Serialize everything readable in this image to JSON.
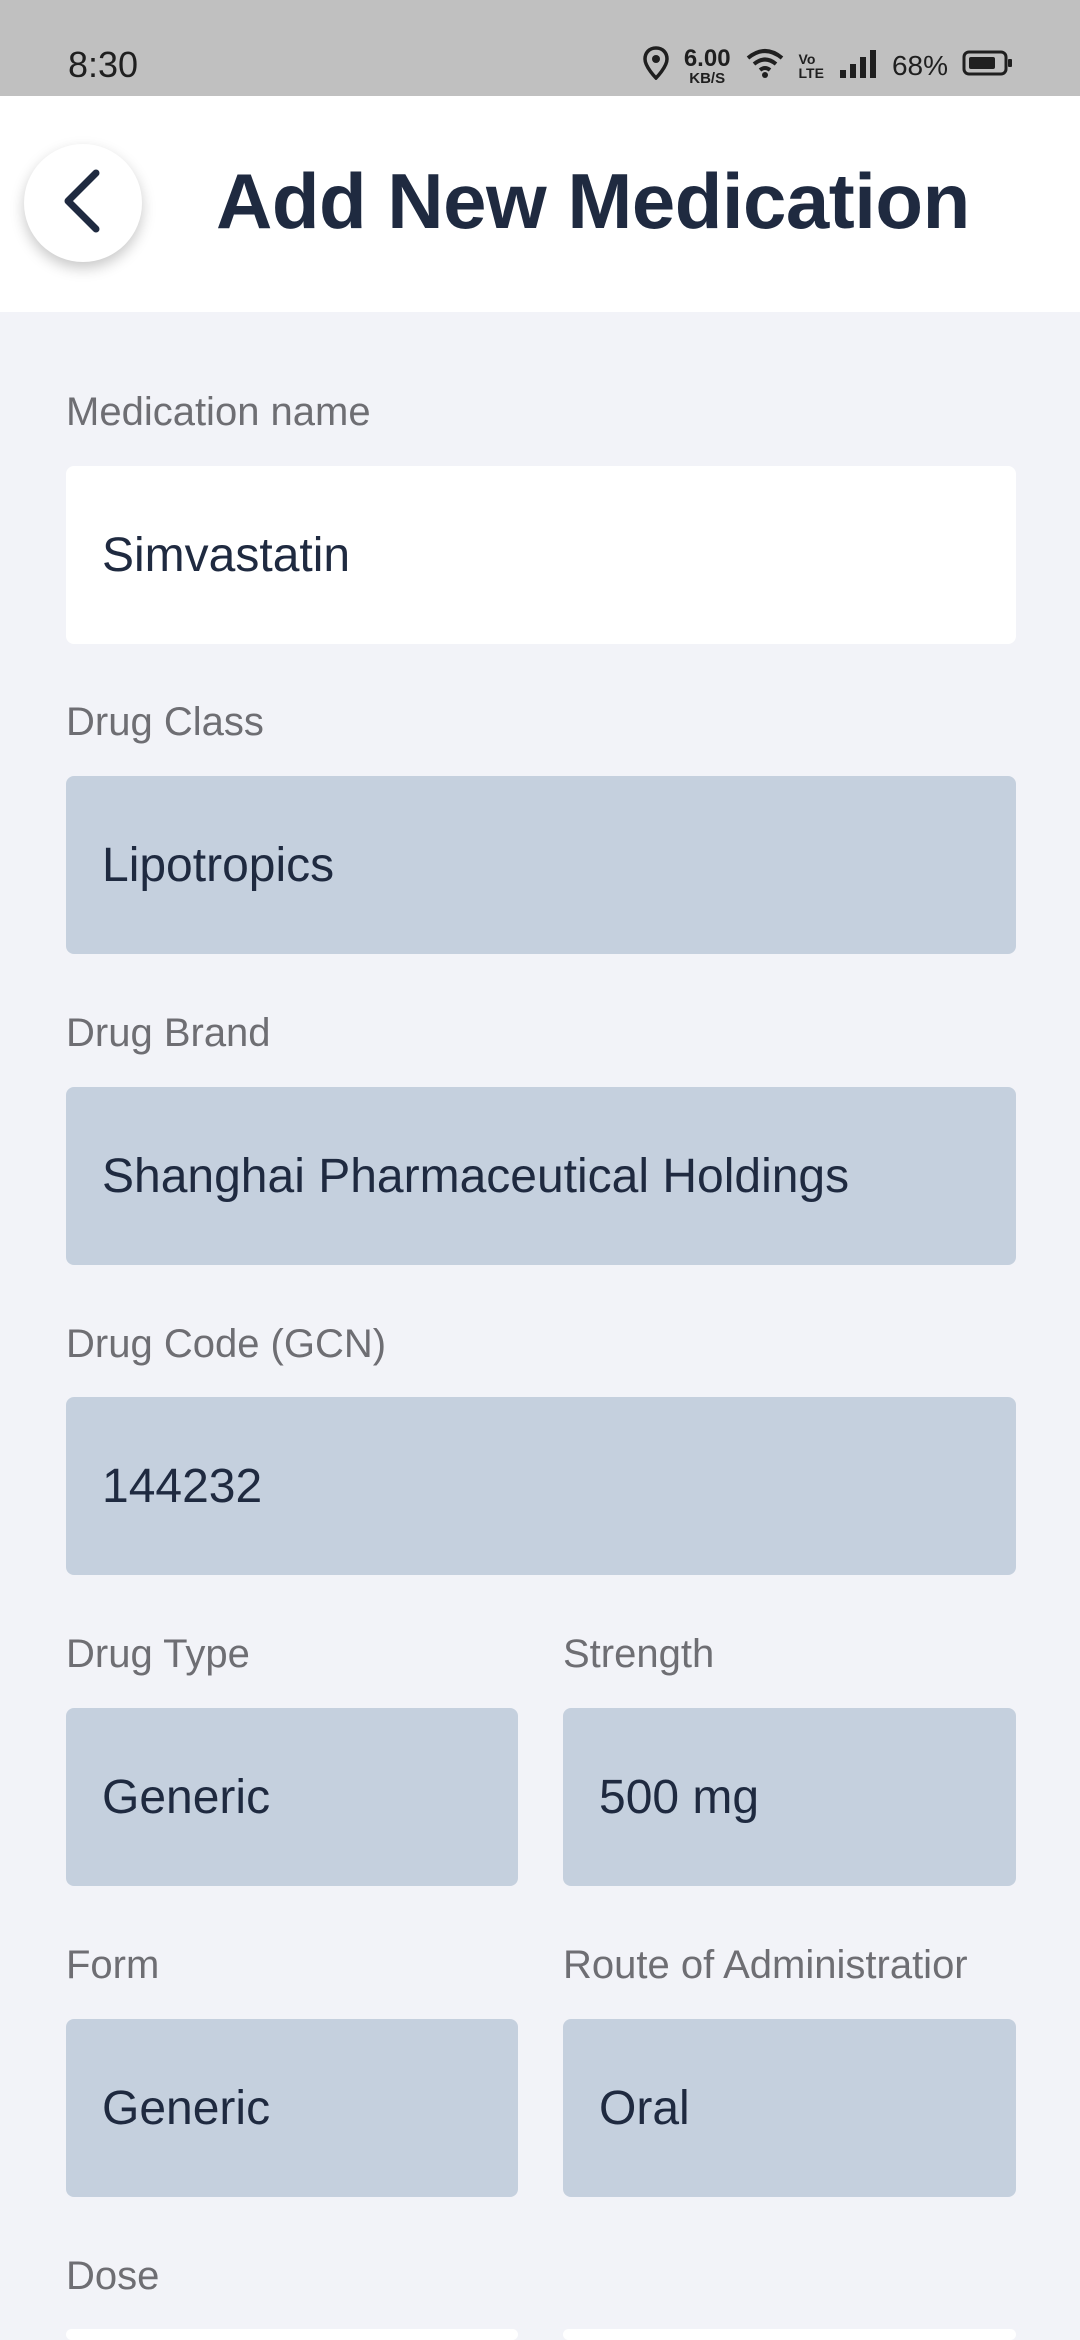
{
  "status_bar": {
    "time": "8:30",
    "speed_value": "6.00",
    "speed_unit": "KB/S",
    "volte_top": "Vo",
    "volte_bottom": "LTE",
    "battery": "68%"
  },
  "header": {
    "title": "Add New Medication"
  },
  "form": {
    "medication_name": {
      "label": "Medication name",
      "value": "Simvastatin"
    },
    "drug_class": {
      "label": "Drug Class",
      "value": "Lipotropics"
    },
    "drug_brand": {
      "label": "Drug Brand",
      "value": "Shanghai Pharmaceutical Holdings"
    },
    "drug_code": {
      "label": "Drug Code (GCN)",
      "value": "144232"
    },
    "drug_type": {
      "label": "Drug Type",
      "value": "Generic"
    },
    "strength": {
      "label": "Strength",
      "value": "500 mg"
    },
    "form": {
      "label": "Form",
      "value": "Generic"
    },
    "route": {
      "label": "Route of Administratior",
      "value": "Oral"
    },
    "dose": {
      "label": "Dose"
    }
  },
  "icons": {
    "back": "chevron-left-icon",
    "location": "location-pin-icon",
    "wifi": "wifi-icon",
    "signal": "signal-icon",
    "battery": "battery-icon"
  }
}
